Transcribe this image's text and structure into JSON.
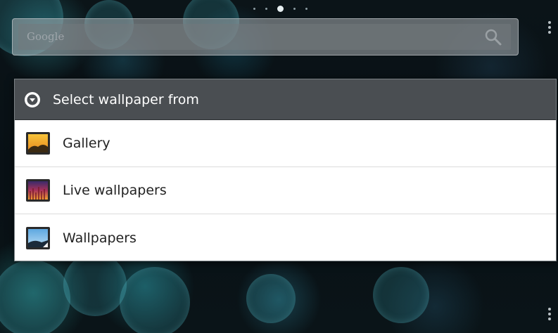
{
  "search": {
    "placeholder": "Google"
  },
  "dialog": {
    "title": "Select wallpaper from",
    "items": [
      {
        "label": "Gallery"
      },
      {
        "label": "Live wallpapers"
      },
      {
        "label": "Wallpapers"
      }
    ]
  },
  "icons": {
    "dialog": "chevron-down-circle-icon",
    "search": "search-icon",
    "gallery": "gallery-icon",
    "live": "live-wallpapers-icon",
    "wallpapers": "wallpapers-icon"
  },
  "colors": {
    "dialog_header": "#4a4e52",
    "dialog_bg": "#ffffff",
    "wallpaper_accent": "#2a8a94"
  }
}
